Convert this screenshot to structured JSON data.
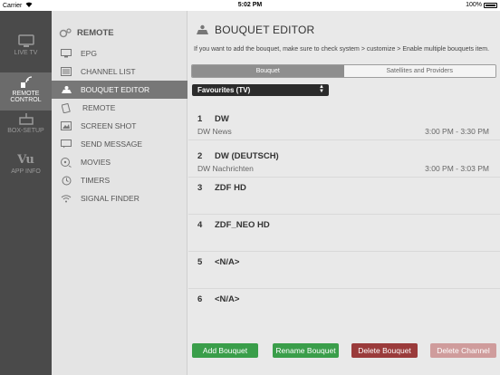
{
  "status_bar": {
    "carrier": "Carrier",
    "time": "5:02 PM",
    "battery": "100%"
  },
  "rail": [
    {
      "label": "LIVE TV",
      "icon": "tv-icon"
    },
    {
      "label_line1": "REMOTE",
      "label_line2": "CONTROL",
      "icon": "remote-icon",
      "active": true
    },
    {
      "label": "BOX-SETUP",
      "icon": "box-icon"
    },
    {
      "label": "APP INFO",
      "icon": "vu-logo-icon",
      "logo_text": "Vu"
    }
  ],
  "menu": {
    "header": "REMOTE",
    "items": [
      {
        "label": "EPG",
        "icon": "monitor-icon"
      },
      {
        "label": "CHANNEL LIST",
        "icon": "list-icon"
      },
      {
        "label": "BOUQUET EDITOR",
        "icon": "bouquet-icon",
        "active": true
      },
      {
        "label": "REMOTE",
        "icon": "remote-small-icon"
      },
      {
        "label": "SCREEN SHOT",
        "icon": "screenshot-icon"
      },
      {
        "label": "SEND MESSAGE",
        "icon": "message-icon"
      },
      {
        "label": "MOVIES",
        "icon": "movies-icon"
      },
      {
        "label": "TIMERS",
        "icon": "clock-icon"
      },
      {
        "label": "SIGNAL FINDER",
        "icon": "wifi-icon"
      }
    ]
  },
  "main": {
    "title": "BOUQUET EDITOR",
    "description": "If you want to add the bouquet, make sure  to check system > customize > Enable multiple bouquets item.",
    "tabs": [
      {
        "label": "Bouquet",
        "active": true
      },
      {
        "label": "Satellites and Providers",
        "active": false
      }
    ],
    "dropdown": {
      "selected": "Favourites (TV)"
    },
    "channels": [
      {
        "num": "1",
        "name": "DW",
        "sub": "DW News",
        "time": "3:00 PM - 3:30 PM"
      },
      {
        "num": "2",
        "name": "DW (DEUTSCH)",
        "sub": "DW Nachrichten",
        "time": "3:00 PM - 3:03 PM"
      },
      {
        "num": "3",
        "name": "ZDF HD",
        "sub": "",
        "time": ""
      },
      {
        "num": "4",
        "name": "ZDF_NEO HD",
        "sub": "",
        "time": ""
      },
      {
        "num": "5",
        "name": "<N/A>",
        "sub": "",
        "time": ""
      },
      {
        "num": "6",
        "name": "<N/A>",
        "sub": "",
        "time": ""
      }
    ],
    "buttons": {
      "add": "Add Bouquet",
      "rename": "Rename Bouquet",
      "delete_bouquet": "Delete Bouquet",
      "delete_channel": "Delete Channel"
    }
  },
  "colors": {
    "green": "#3a9e4a",
    "red": "#9a3b3b",
    "faded_red": "#cf9c9c",
    "rail": "#4a4a4a"
  }
}
